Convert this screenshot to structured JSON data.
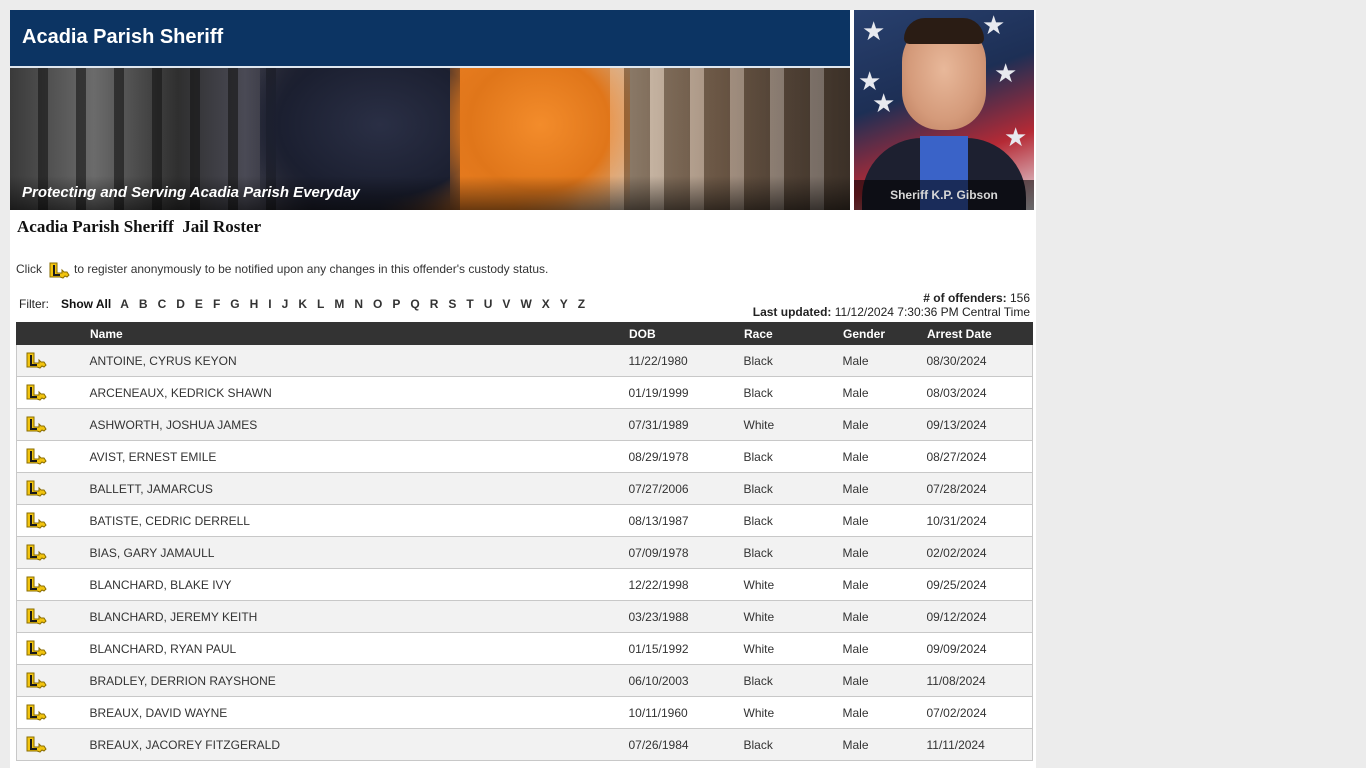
{
  "header": {
    "title": "Acadia Parish Sheriff",
    "tagline": "Protecting and Serving Acadia Parish Everyday",
    "sheriff_caption": "Sheriff K.P. Gibson"
  },
  "page_title": "Acadia Parish Sheriff  Jail Roster",
  "notice": {
    "prefix": "Click",
    "suffix": "to register anonymously to be notified upon any changes in this offender's custody status."
  },
  "filter": {
    "label": "Filter:",
    "show_all": "Show All",
    "letters": [
      "A",
      "B",
      "C",
      "D",
      "E",
      "F",
      "G",
      "H",
      "I",
      "J",
      "K",
      "L",
      "M",
      "N",
      "O",
      "P",
      "Q",
      "R",
      "S",
      "T",
      "U",
      "V",
      "W",
      "X",
      "Y",
      "Z"
    ]
  },
  "stats": {
    "offenders_label": "# of offenders:",
    "offenders_count": "156",
    "updated_label": "Last updated:",
    "updated_value": "11/12/2024 7:30:36 PM Central Time"
  },
  "table": {
    "columns": [
      "",
      "Name",
      "DOB",
      "Race",
      "Gender",
      "Arrest Date"
    ],
    "rows": [
      {
        "name": "ANTOINE, CYRUS KEYON",
        "dob": "11/22/1980",
        "race": "Black",
        "gender": "Male",
        "arrest_date": "08/30/2024"
      },
      {
        "name": "ARCENEAUX, KEDRICK SHAWN",
        "dob": "01/19/1999",
        "race": "Black",
        "gender": "Male",
        "arrest_date": "08/03/2024"
      },
      {
        "name": "ASHWORTH, JOSHUA JAMES",
        "dob": "07/31/1989",
        "race": "White",
        "gender": "Male",
        "arrest_date": "09/13/2024"
      },
      {
        "name": "AVIST, ERNEST EMILE",
        "dob": "08/29/1978",
        "race": "Black",
        "gender": "Male",
        "arrest_date": "08/27/2024"
      },
      {
        "name": "BALLETT, JAMARCUS",
        "dob": "07/27/2006",
        "race": "Black",
        "gender": "Male",
        "arrest_date": "07/28/2024"
      },
      {
        "name": "BATISTE, CEDRIC DERRELL",
        "dob": "08/13/1987",
        "race": "Black",
        "gender": "Male",
        "arrest_date": "10/31/2024"
      },
      {
        "name": "BIAS, GARY JAMAULL",
        "dob": "07/09/1978",
        "race": "Black",
        "gender": "Male",
        "arrest_date": "02/02/2024"
      },
      {
        "name": "BLANCHARD, BLAKE IVY",
        "dob": "12/22/1998",
        "race": "White",
        "gender": "Male",
        "arrest_date": "09/25/2024"
      },
      {
        "name": "BLANCHARD, JEREMY KEITH",
        "dob": "03/23/1988",
        "race": "White",
        "gender": "Male",
        "arrest_date": "09/12/2024"
      },
      {
        "name": "BLANCHARD, RYAN PAUL",
        "dob": "01/15/1992",
        "race": "White",
        "gender": "Male",
        "arrest_date": "09/09/2024"
      },
      {
        "name": "BRADLEY, DERRION RAYSHONE",
        "dob": "06/10/2003",
        "race": "Black",
        "gender": "Male",
        "arrest_date": "11/08/2024"
      },
      {
        "name": "BREAUX, DAVID WAYNE",
        "dob": "10/11/1960",
        "race": "White",
        "gender": "Male",
        "arrest_date": "07/02/2024"
      },
      {
        "name": "BREAUX, JACOREY FITZGERALD",
        "dob": "07/26/1984",
        "race": "Black",
        "gender": "Male",
        "arrest_date": "11/11/2024"
      }
    ]
  },
  "icons": {
    "vine": "louisiana-vine-icon"
  },
  "colors": {
    "header_blue": "#0c3463",
    "table_header": "#333333",
    "row_alt": "#f2f2f2",
    "vine_yellow": "#f2c40f"
  }
}
